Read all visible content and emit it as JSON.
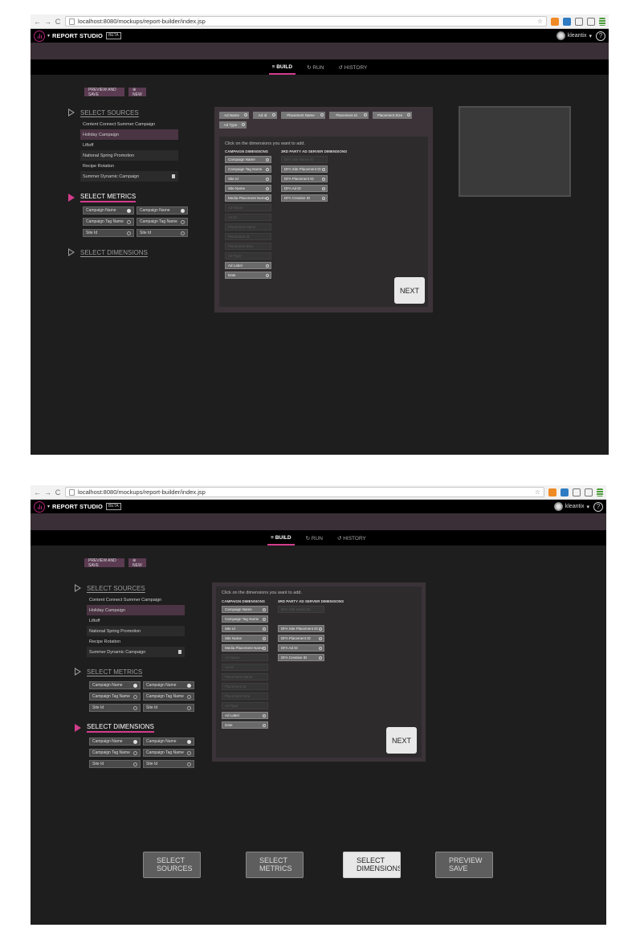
{
  "browser": {
    "url": "localhost:8080/mockups/report-builder/index.jsp",
    "back": "←",
    "forward": "→",
    "reload": "C",
    "star": "☆"
  },
  "app": {
    "brand": "REPORT STUDIO",
    "beta": "BETA",
    "caret": "▾",
    "user": "kleantix",
    "user_caret": "▾",
    "help": "?"
  },
  "tabs": [
    {
      "label": "BUILD",
      "icon": "≡"
    },
    {
      "label": "RUN",
      "icon": "↻"
    },
    {
      "label": "HISTORY",
      "icon": "↺"
    }
  ],
  "actions": {
    "preview_save": "PREVIEW AND SAVE",
    "new": "⊕ NEW"
  },
  "steps": {
    "sources": "SELECT SOURCES",
    "metrics": "SELECT METRICS",
    "dimensions": "SELECT DIMENSIONS"
  },
  "sources": [
    "Content Connect Summer Campaign",
    "Holiday Campaign",
    "Liftoff",
    "National Spring Promotion",
    "Recipe Rotation",
    "Summer Dynamic Campaign"
  ],
  "metrics": [
    "Campaign Name",
    "Campaign Name",
    "Campaign Tag Name",
    "Campaign Tag Name",
    "Site Id",
    "Site Id"
  ],
  "selected_dimensions": [
    "Ad Name",
    "Ad Id",
    "Placement Name",
    "Placement Id",
    "Placement Size",
    "Ad Type"
  ],
  "panel": {
    "hint": "Click on the dimensions you want to add.",
    "campaign_head": "CAMPAIGN DIMENSIONS",
    "third_party_head": "3RD PARTY AD SERVER DIMENSIONS",
    "next": "NEXT"
  },
  "campaign_dimensions": [
    {
      "label": "Campaign Name",
      "enabled": true
    },
    {
      "label": "Campaign Tag Name",
      "enabled": true
    },
    {
      "label": "Site Id",
      "enabled": true
    },
    {
      "label": "Site Name",
      "enabled": true
    },
    {
      "label": "Media Placement Name",
      "enabled": true
    },
    {
      "label": "Ad Name",
      "enabled": false
    },
    {
      "label": "Ad Id",
      "enabled": false
    },
    {
      "label": "Placement Name",
      "enabled": false
    },
    {
      "label": "Placement Id",
      "enabled": false
    },
    {
      "label": "Placement Size",
      "enabled": false
    },
    {
      "label": "Ad Type",
      "enabled": false
    },
    {
      "label": "Ad Label",
      "enabled": true
    },
    {
      "label": "Date",
      "enabled": true
    }
  ],
  "third_party_dimensions": [
    {
      "label": "DFA Site Name ID",
      "enabled": false
    },
    {
      "label": "DFA Site Placement ID",
      "enabled": true
    },
    {
      "label": "DFA Placement ID",
      "enabled": true
    },
    {
      "label": "DFA Ad ID",
      "enabled": true
    },
    {
      "label": "DFA Creative ID",
      "enabled": true
    }
  ],
  "bottom_nav": [
    "SELECT SOURCES",
    "SELECT METRICS",
    "SELECT DIMENSIONS",
    "PREVIEW SAVE"
  ]
}
